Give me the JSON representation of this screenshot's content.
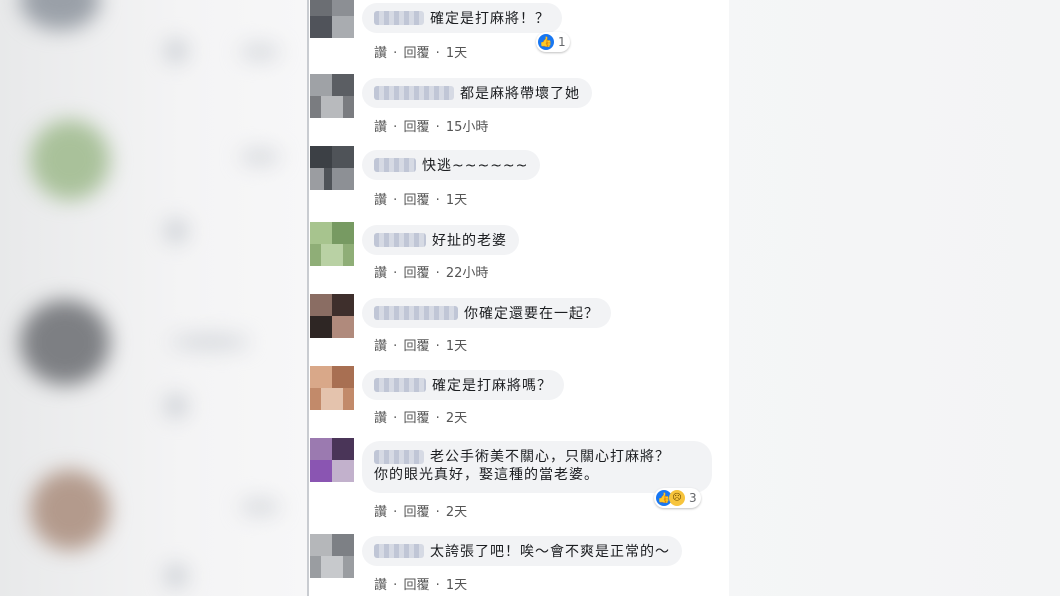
{
  "actions": {
    "like": "讚",
    "reply": "回覆",
    "sep": "·"
  },
  "comments": [
    {
      "text": "確定是打麻將！？",
      "time": "1天",
      "reaction_count": "1"
    },
    {
      "text": "都是麻將帶壞了她",
      "time": "15小時"
    },
    {
      "text": "快逃~~~~~~",
      "time": "1天"
    },
    {
      "text": "好扯的老婆",
      "time": "22小時"
    },
    {
      "text": "你確定還要在一起？",
      "time": "1天"
    },
    {
      "text": "確定是打麻將嗎？",
      "time": "2天"
    },
    {
      "lines": [
        "老公手術美不關心，只關心打麻將？",
        "你的眼光真好，娶這種的當老婆。"
      ],
      "time": "2天",
      "reaction_count": "3"
    },
    {
      "text": "太誇張了吧！唉～會不爽是正常的～",
      "time": "1天"
    }
  ],
  "colors": {
    "like_blue": "#1877f2",
    "bubble_bg": "#f2f3f5"
  }
}
